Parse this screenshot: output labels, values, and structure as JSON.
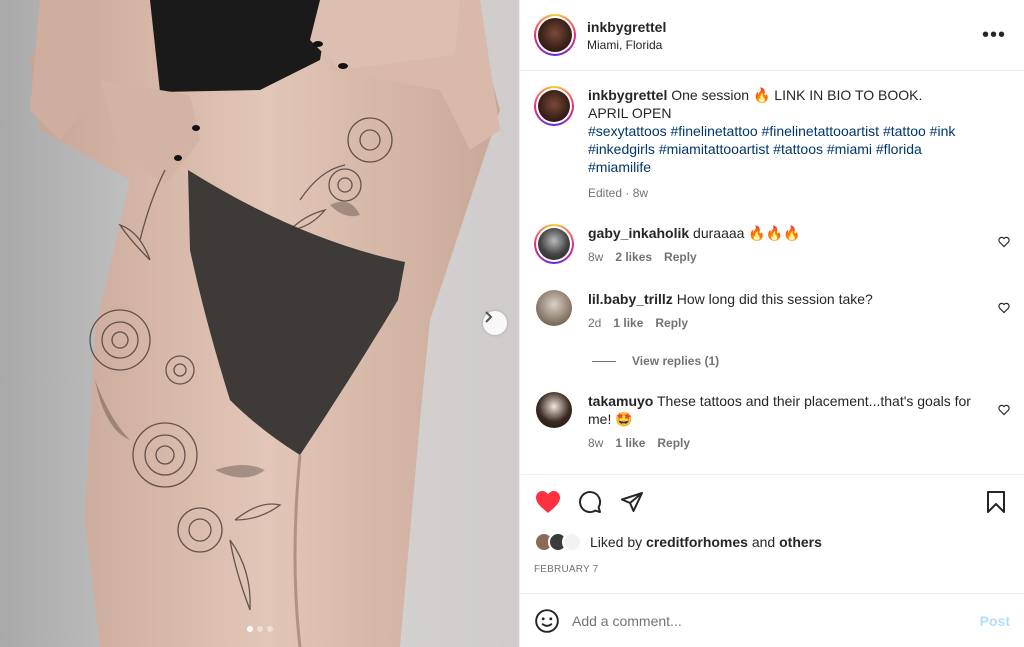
{
  "post": {
    "username": "inkbygrettel",
    "location": "Miami, Florida",
    "more_label": "•••",
    "caption": {
      "username": "inkbygrettel",
      "text_line1": "One session 🔥 LINK IN BIO TO BOOK.",
      "text_line2": "APRIL OPEN",
      "hashtags_line1": "#sexytattoos #finelinetattoo #finelinetattooartist #tattoo #ink",
      "hashtags_line2": "#inkedgirls #miamitattooartist #tattoos #miami #florida",
      "hashtags_line3": "#miamilife",
      "meta": "Edited · 8w"
    },
    "comments": [
      {
        "username": "gaby_inkaholik",
        "text": "duraaaa 🔥🔥🔥",
        "age": "8w",
        "likes": "2 likes",
        "reply": "Reply"
      },
      {
        "username": "lil.baby_trillz",
        "text": "How long did this session take?",
        "age": "2d",
        "likes": "1 like",
        "reply": "Reply"
      },
      {
        "username": "takamuyo",
        "text": "These tattoos and their placement...that's goals for",
        "text2": "me! 🤩",
        "age": "8w",
        "likes": "1 like",
        "reply": "Reply"
      }
    ],
    "view_replies": "View replies (1)",
    "likes": {
      "prefix": "Liked by",
      "user": "creditforhomes",
      "and": "and",
      "others": "others"
    },
    "date": "FEBRUARY 7",
    "add_comment_placeholder": "Add a comment...",
    "post_label": "Post",
    "carousel": {
      "total": 3,
      "current": 1
    },
    "liked": true,
    "colors": {
      "like_red": "#ff3040",
      "link_blue": "#00376b",
      "post_disabled": "#b2dffc",
      "muted": "#737373"
    }
  }
}
